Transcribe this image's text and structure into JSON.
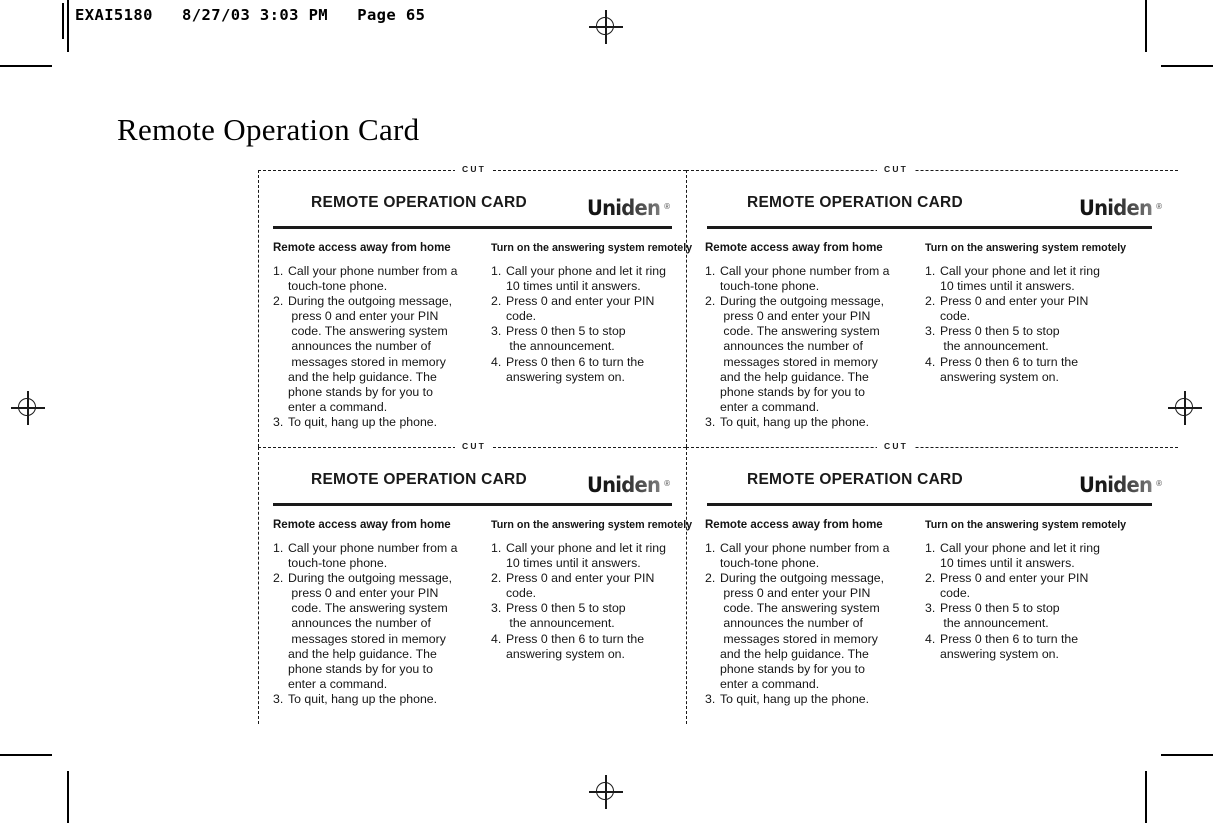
{
  "print_marks": {
    "registration_icon": "registration-target-icon",
    "crop_icon": "crop-mark-icon"
  },
  "slug": {
    "text": "EXAI5180   8/27/03 3:03 PM   Page 65"
  },
  "page": {
    "title": "Remote Operation Card"
  },
  "card": {
    "cut_label": "CUT",
    "title": "REMOTE OPERATION CARD",
    "logo_text": "Uniden",
    "logo_tm": "®",
    "columns": [
      {
        "heading": "Remote access away from home",
        "steps": [
          [
            "Call your phone number from a",
            "touch-tone phone."
          ],
          [
            "During the outgoing message,",
            " press 0 and enter your PIN",
            " code. The answering system",
            " announces the number of",
            " messages stored in memory",
            "and the help guidance. The",
            "phone stands by for you to",
            "enter a command."
          ],
          [
            "To quit, hang up the phone."
          ]
        ]
      },
      {
        "heading": "Turn on the answering system remotely",
        "steps": [
          [
            "Call your phone and let it ring",
            "10 times until it answers."
          ],
          [
            "Press 0 and enter your PIN",
            "code."
          ],
          [
            "Press 0 then 5 to stop",
            " the announcement."
          ],
          [
            "Press 0 then 6 to turn the",
            "answering system on."
          ]
        ]
      }
    ]
  },
  "grid": {
    "rows": 2,
    "cols": 2
  }
}
